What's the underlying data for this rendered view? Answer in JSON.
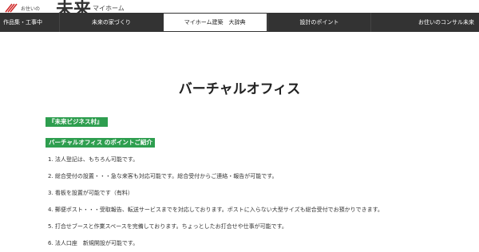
{
  "header": {
    "logo_small": "お住いの",
    "logo_big": "未来",
    "logo_sub": "マイホーム",
    "logo_color": "#d12b2b"
  },
  "nav": {
    "items": [
      {
        "label": "作品集・工事中"
      },
      {
        "label": "未来の家づくり"
      },
      {
        "label": "マイホーム建築　大辞典",
        "active": true
      },
      {
        "label": "設計のポイント"
      },
      {
        "label": "お住いのコンサル未来"
      }
    ]
  },
  "main": {
    "title": "バーチャルオフィス",
    "badge_village": "『未来ビジネス村』",
    "badge_points": "バーチャルオフィス のポイントご紹介",
    "accent_color": "#2e9e4f",
    "points": [
      "1. 法人登記は、もちろん可能です。",
      "2. 総合受付の設置・・・急な来客も対応可能です。総合受付からご連絡・報告が可能です。",
      "3. 看板を設置が可能です（有料）",
      "4. 郵便ポスト・・・受取報告、転送サービスまでを対応しております。ポストに入らない大型サイズも総合受付でお預かりできます。",
      "5. 打合せブースと作業スペースを完備しております。ちょっとしたお打合せや仕事が可能です。",
      "6. 法人口座　新規開設が可能です。"
    ]
  }
}
